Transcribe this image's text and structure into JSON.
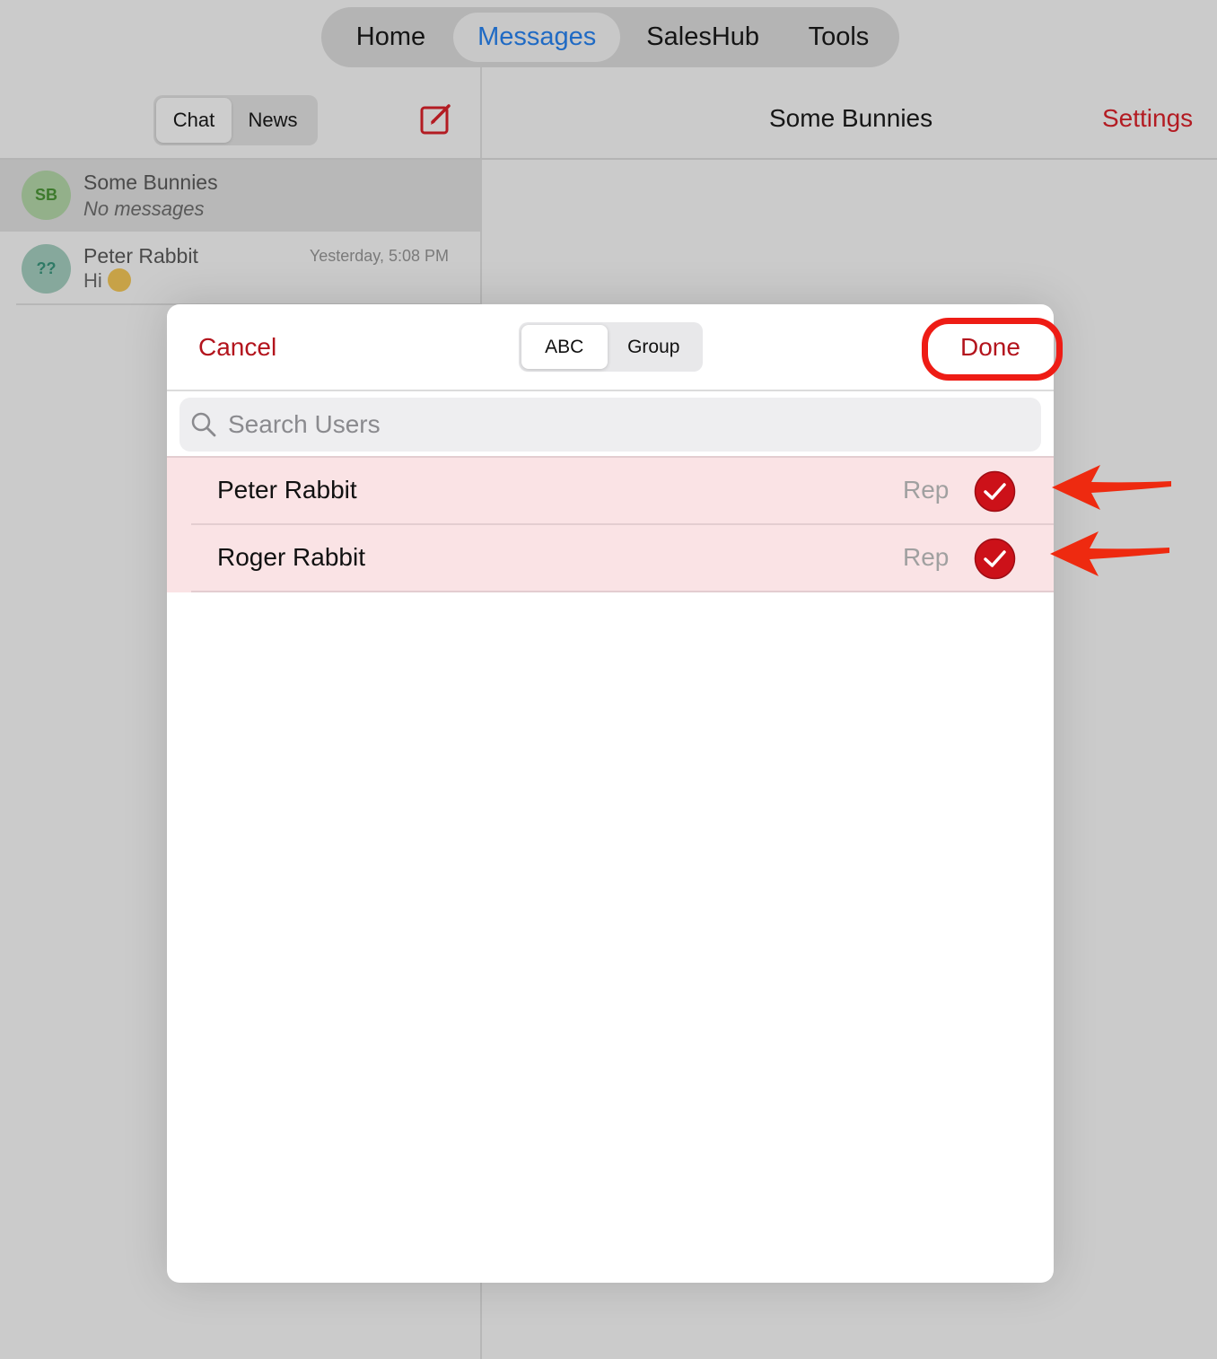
{
  "top_tabs": {
    "home": "Home",
    "messages": "Messages",
    "saleshub": "SalesHub",
    "tools": "Tools"
  },
  "left_panel": {
    "segment": {
      "chat": "Chat",
      "news": "News"
    },
    "compose_icon": "compose-icon",
    "chats": [
      {
        "initials": "SB",
        "name": "Some Bunnies",
        "preview": "No messages",
        "time": ""
      },
      {
        "initials": "??",
        "name": "Peter Rabbit",
        "preview": "Hi",
        "time": "Yesterday, 5:08 PM"
      }
    ]
  },
  "conversation": {
    "title": "Some Bunnies",
    "settings_label": "Settings"
  },
  "modal": {
    "cancel_label": "Cancel",
    "done_label": "Done",
    "segment": {
      "abc": "ABC",
      "group": "Group"
    },
    "search": {
      "placeholder": "Search Users",
      "value": ""
    },
    "users": [
      {
        "name": "Peter Rabbit",
        "role": "Rep",
        "selected": true
      },
      {
        "name": "Roger Rabbit",
        "role": "Rep",
        "selected": true
      }
    ]
  },
  "colors": {
    "accent_red": "#b3141d",
    "active_tab_blue": "#1f6ac4",
    "selected_row_bg": "#fae3e5",
    "annotation_red": "#ee1c15"
  }
}
